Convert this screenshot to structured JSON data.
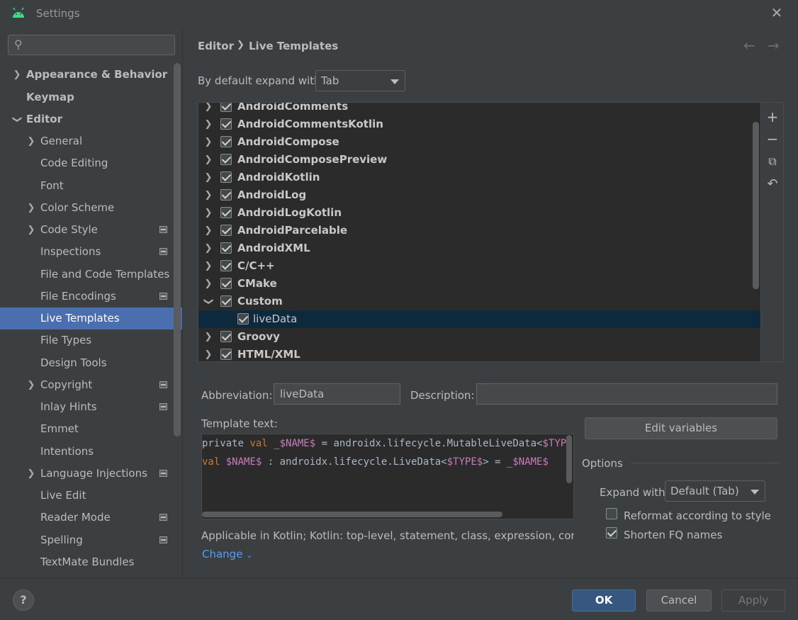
{
  "window": {
    "title": "Settings"
  },
  "search": {
    "placeholder": ""
  },
  "sidebar": {
    "items": [
      {
        "label": "Appearance & Behavior"
      },
      {
        "label": "Keymap"
      },
      {
        "label": "Editor"
      },
      {
        "label": "General"
      },
      {
        "label": "Code Editing"
      },
      {
        "label": "Font"
      },
      {
        "label": "Color Scheme"
      },
      {
        "label": "Code Style"
      },
      {
        "label": "Inspections"
      },
      {
        "label": "File and Code Templates"
      },
      {
        "label": "File Encodings"
      },
      {
        "label": "Live Templates"
      },
      {
        "label": "File Types"
      },
      {
        "label": "Design Tools"
      },
      {
        "label": "Copyright"
      },
      {
        "label": "Inlay Hints"
      },
      {
        "label": "Emmet"
      },
      {
        "label": "Intentions"
      },
      {
        "label": "Language Injections"
      },
      {
        "label": "Live Edit"
      },
      {
        "label": "Reader Mode"
      },
      {
        "label": "Spelling"
      },
      {
        "label": "TextMate Bundles"
      }
    ]
  },
  "breadcrumb": {
    "parent": "Editor",
    "current": "Live Templates"
  },
  "expand": {
    "label": "By default expand with",
    "value": "Tab"
  },
  "templates": {
    "groups": [
      {
        "label": "AndroidComments"
      },
      {
        "label": "AndroidCommentsKotlin"
      },
      {
        "label": "AndroidCompose"
      },
      {
        "label": "AndroidComposePreview"
      },
      {
        "label": "AndroidKotlin"
      },
      {
        "label": "AndroidLog"
      },
      {
        "label": "AndroidLogKotlin"
      },
      {
        "label": "AndroidParcelable"
      },
      {
        "label": "AndroidXML"
      },
      {
        "label": "C/C++"
      },
      {
        "label": "CMake"
      },
      {
        "label": "Custom"
      },
      {
        "label": "liveData"
      },
      {
        "label": "Groovy"
      },
      {
        "label": "HTML/XML"
      }
    ]
  },
  "form": {
    "abbreviation_label": "Abbreviation:",
    "abbreviation_value": "liveData",
    "description_label": "Description:",
    "description_value": "",
    "template_text_label": "Template text:",
    "code_line1": {
      "a": "private ",
      "b": "val",
      "c": " _",
      "d": "$NAME$",
      "e": " = androidx.lifecycle.MutableLiveData<",
      "f": "$TYPE$",
      "g": ">(",
      "h": "$"
    },
    "code_line2": {
      "a": "val",
      "b": " ",
      "c": "$NAME$",
      "d": " : androidx.lifecycle.LiveData<",
      "e": "$TYPE$",
      "f": "> = _",
      "g": "$NAME$"
    },
    "applicable": "Applicable in Kotlin; Kotlin: top-level, statement, class, expression, comment, d",
    "change_link": "Change"
  },
  "options": {
    "title": "Options",
    "edit_variables": "Edit variables",
    "expand_with_label": "Expand with",
    "expand_with_value": "Default (Tab)",
    "reformat_label": "Reformat according to style",
    "reformat_checked": false,
    "shorten_label": "Shorten FQ names",
    "shorten_checked": true
  },
  "footer": {
    "ok": "OK",
    "cancel": "Cancel",
    "apply": "Apply",
    "help": "?"
  }
}
